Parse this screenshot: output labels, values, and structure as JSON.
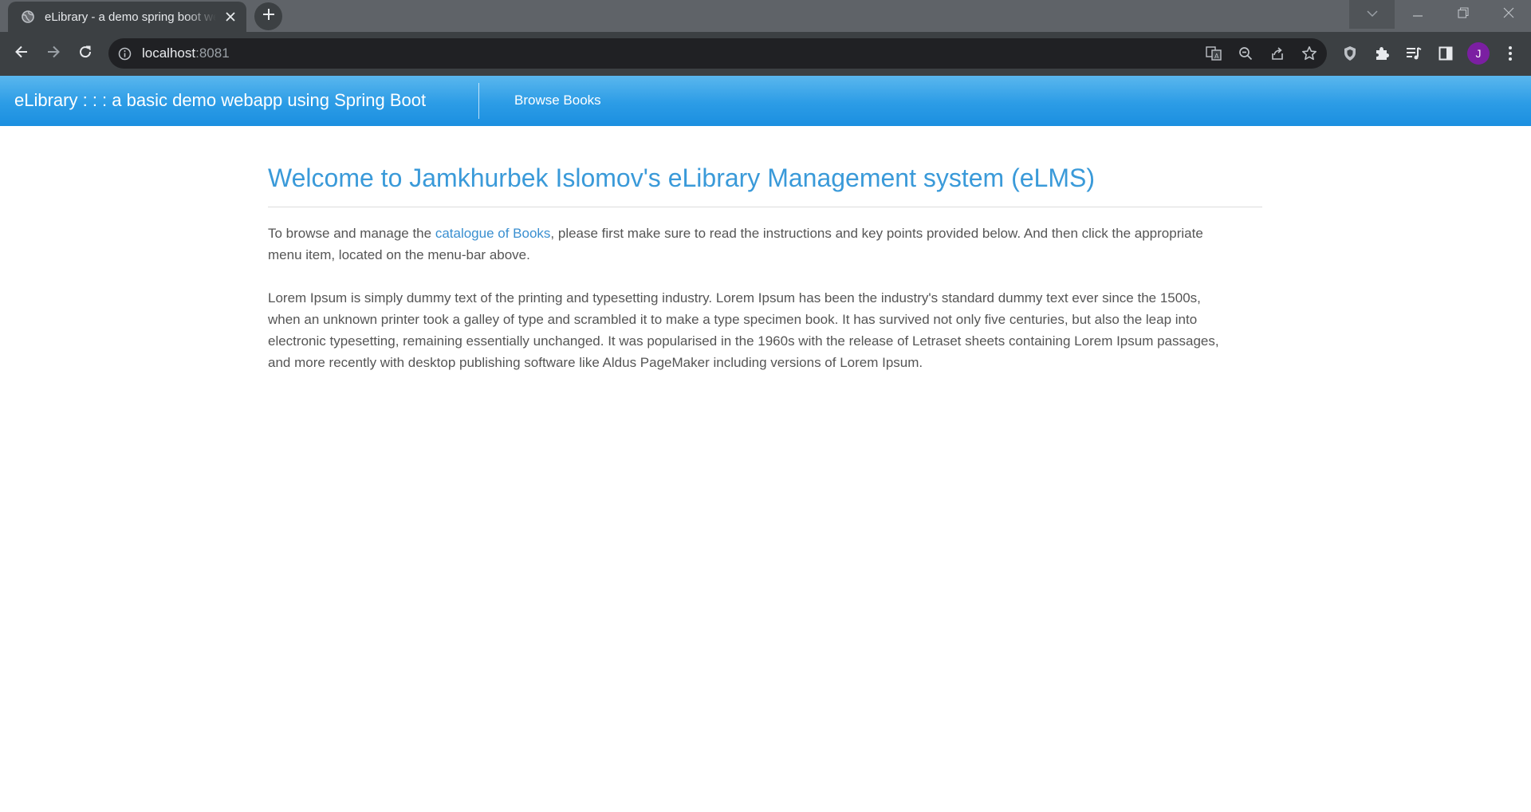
{
  "browser": {
    "tab": {
      "title": "eLibrary - a demo spring boot webapp",
      "favicon": "globe-icon",
      "close_icon": "close-icon"
    },
    "new_tab_icon": "plus-icon",
    "window_controls": [
      "tab-search-icon",
      "minimize-icon",
      "restore-icon",
      "close-icon"
    ],
    "address_bar": {
      "info_icon": "info-icon",
      "host": "localhost",
      "port": ":8081"
    },
    "toolbar_icons": [
      "translate-icon",
      "zoom-icon",
      "share-icon",
      "bookmark-star-icon",
      "shield-extension-icon",
      "extensions-puzzle-icon",
      "reading-list-icon",
      "side-panel-icon"
    ],
    "profile_initial": "J"
  },
  "navbar": {
    "brand": "eLibrary : : : a basic demo webapp using Spring Boot",
    "links": [
      "Browse Books"
    ],
    "gradient_top": "#5ab7ee",
    "gradient_bottom": "#1b8fe0"
  },
  "main": {
    "title": "Welcome to Jamkhurbek Islomov's eLibrary Management system (eLMS)",
    "intro": {
      "before_link": "To browse and manage the ",
      "link_text": "catalogue of Books",
      "after_link_line1": ", please first make sure to read the instructions and key points provided below. And then click the appropriate",
      "line2": "menu item, located on the menu-bar above."
    },
    "lorem_lines": [
      "Lorem Ipsum is simply dummy text of the printing and typesetting industry. Lorem Ipsum has been the industry's standard dummy text ever since the 1500s,",
      "when an unknown printer took a galley of type and scrambled it to make a type specimen book. It has survived not only five centuries, but also the leap into",
      "electronic typesetting, remaining essentially unchanged. It was popularised in the 1960s with the release of Letraset sheets containing Lorem Ipsum passages,",
      "and more recently with desktop publishing software like Aldus PageMaker including versions of Lorem Ipsum."
    ],
    "title_color": "#3a9ad9",
    "link_color": "#3a8fd0"
  }
}
